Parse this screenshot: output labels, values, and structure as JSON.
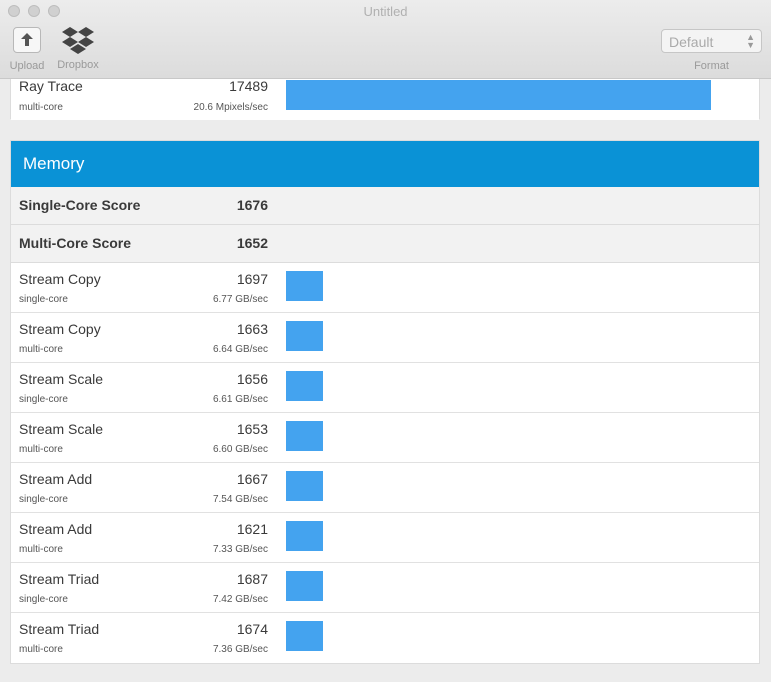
{
  "window": {
    "title": "Untitled"
  },
  "toolbar": {
    "upload_label": "Upload",
    "dropbox_label": "Dropbox",
    "format_value": "Default",
    "format_label": "Format"
  },
  "colors": {
    "accent": "#0a92d6",
    "bar": "#44a3ef"
  },
  "ray_trace": {
    "name": "Ray Trace",
    "type": "multi-core",
    "score": "17489",
    "rate": "20.6 Mpixels/sec",
    "bar_fraction": 1.0
  },
  "memory": {
    "title": "Memory",
    "single_core": {
      "label": "Single-Core Score",
      "value": "1676"
    },
    "multi_core": {
      "label": "Multi-Core Score",
      "value": "1652"
    },
    "rows": [
      {
        "name": "Stream Copy",
        "type": "single-core",
        "score": "1697",
        "rate": "6.77 GB/sec",
        "bar_fraction": 0.087
      },
      {
        "name": "Stream Copy",
        "type": "multi-core",
        "score": "1663",
        "rate": "6.64 GB/sec",
        "bar_fraction": 0.087
      },
      {
        "name": "Stream Scale",
        "type": "single-core",
        "score": "1656",
        "rate": "6.61 GB/sec",
        "bar_fraction": 0.087
      },
      {
        "name": "Stream Scale",
        "type": "multi-core",
        "score": "1653",
        "rate": "6.60 GB/sec",
        "bar_fraction": 0.087
      },
      {
        "name": "Stream Add",
        "type": "single-core",
        "score": "1667",
        "rate": "7.54 GB/sec",
        "bar_fraction": 0.087
      },
      {
        "name": "Stream Add",
        "type": "multi-core",
        "score": "1621",
        "rate": "7.33 GB/sec",
        "bar_fraction": 0.087
      },
      {
        "name": "Stream Triad",
        "type": "single-core",
        "score": "1687",
        "rate": "7.42 GB/sec",
        "bar_fraction": 0.087
      },
      {
        "name": "Stream Triad",
        "type": "multi-core",
        "score": "1674",
        "rate": "7.36 GB/sec",
        "bar_fraction": 0.087
      }
    ]
  }
}
